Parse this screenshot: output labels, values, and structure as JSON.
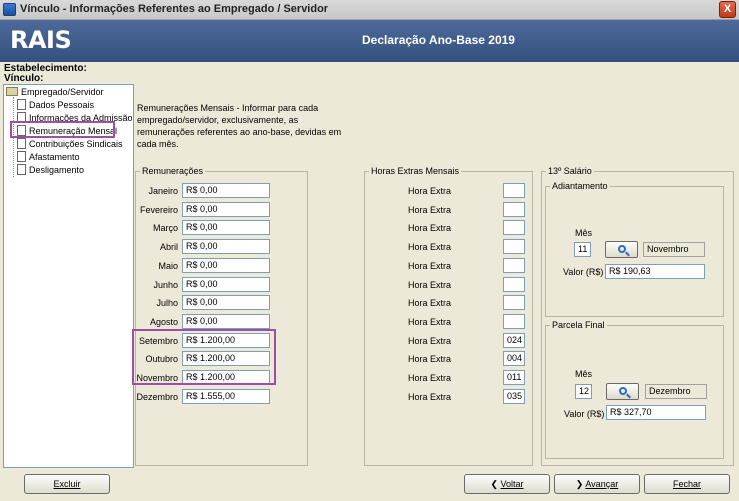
{
  "window": {
    "title": "Vínculo - Informações Referentes ao Empregado / Servidor",
    "close_glyph": "X"
  },
  "banner": {
    "logo": "RAIS",
    "declaration": "Declaração Ano-Base 2019"
  },
  "labels": {
    "estabelecimento": "Estabelecimento:",
    "vinculo": "Vínculo:"
  },
  "tree": {
    "root": "Empregado/Servidor",
    "items": [
      {
        "label": "Dados Pessoais"
      },
      {
        "label": "Informações da Admissão"
      },
      {
        "label": "Remuneração Mensal",
        "selected": true
      },
      {
        "label": "Contribuições Sindicais"
      },
      {
        "label": "Afastamento"
      },
      {
        "label": "Desligamento"
      }
    ]
  },
  "description": "Remunerações Mensais - Informar para cada empregado/servidor, exclusivamente, as remunerações referentes ao ano-base, devidas em cada mês.",
  "remuneracoes": {
    "title": "Remunerações",
    "rows": [
      {
        "month": "Janeiro",
        "value": "R$ 0,00"
      },
      {
        "month": "Fevereiro",
        "value": "R$ 0,00"
      },
      {
        "month": "Março",
        "value": "R$ 0,00"
      },
      {
        "month": "Abril",
        "value": "R$ 0,00"
      },
      {
        "month": "Maio",
        "value": "R$ 0,00"
      },
      {
        "month": "Junho",
        "value": "R$ 0,00"
      },
      {
        "month": "Julho",
        "value": "R$ 0,00"
      },
      {
        "month": "Agosto",
        "value": "R$ 0,00"
      },
      {
        "month": "Setembro",
        "value": "R$ 1.200,00"
      },
      {
        "month": "Outubro",
        "value": "R$ 1.200,00"
      },
      {
        "month": "Novembro",
        "value": "R$ 1.200,00"
      },
      {
        "month": "Dezembro",
        "value": "R$ 1.555,00"
      }
    ]
  },
  "horas_extras": {
    "title": "Horas Extras Mensais",
    "row_label": "Hora Extra",
    "values": [
      "",
      "",
      "",
      "",
      "",
      "",
      "",
      "",
      "024",
      "004",
      "011",
      "035"
    ]
  },
  "decimo_terceiro": {
    "title": "13º Salário",
    "adiantamento": {
      "title": "Adiantamento",
      "mes_label": "Mês",
      "mes": "11",
      "mes_nome": "Novembro",
      "valor_label": "Valor (R$)",
      "valor": "R$ 190,63"
    },
    "parcela_final": {
      "title": "Parcela Final",
      "mes_label": "Mês",
      "mes": "12",
      "mes_nome": "Dezembro",
      "valor_label": "Valor (R$)",
      "valor": "R$ 327,70"
    }
  },
  "buttons": {
    "excluir": "Excluir",
    "voltar": "Voltar",
    "avancar": "Avançar",
    "fechar": "Fechar"
  },
  "highlight_color": "#9b4fa5"
}
